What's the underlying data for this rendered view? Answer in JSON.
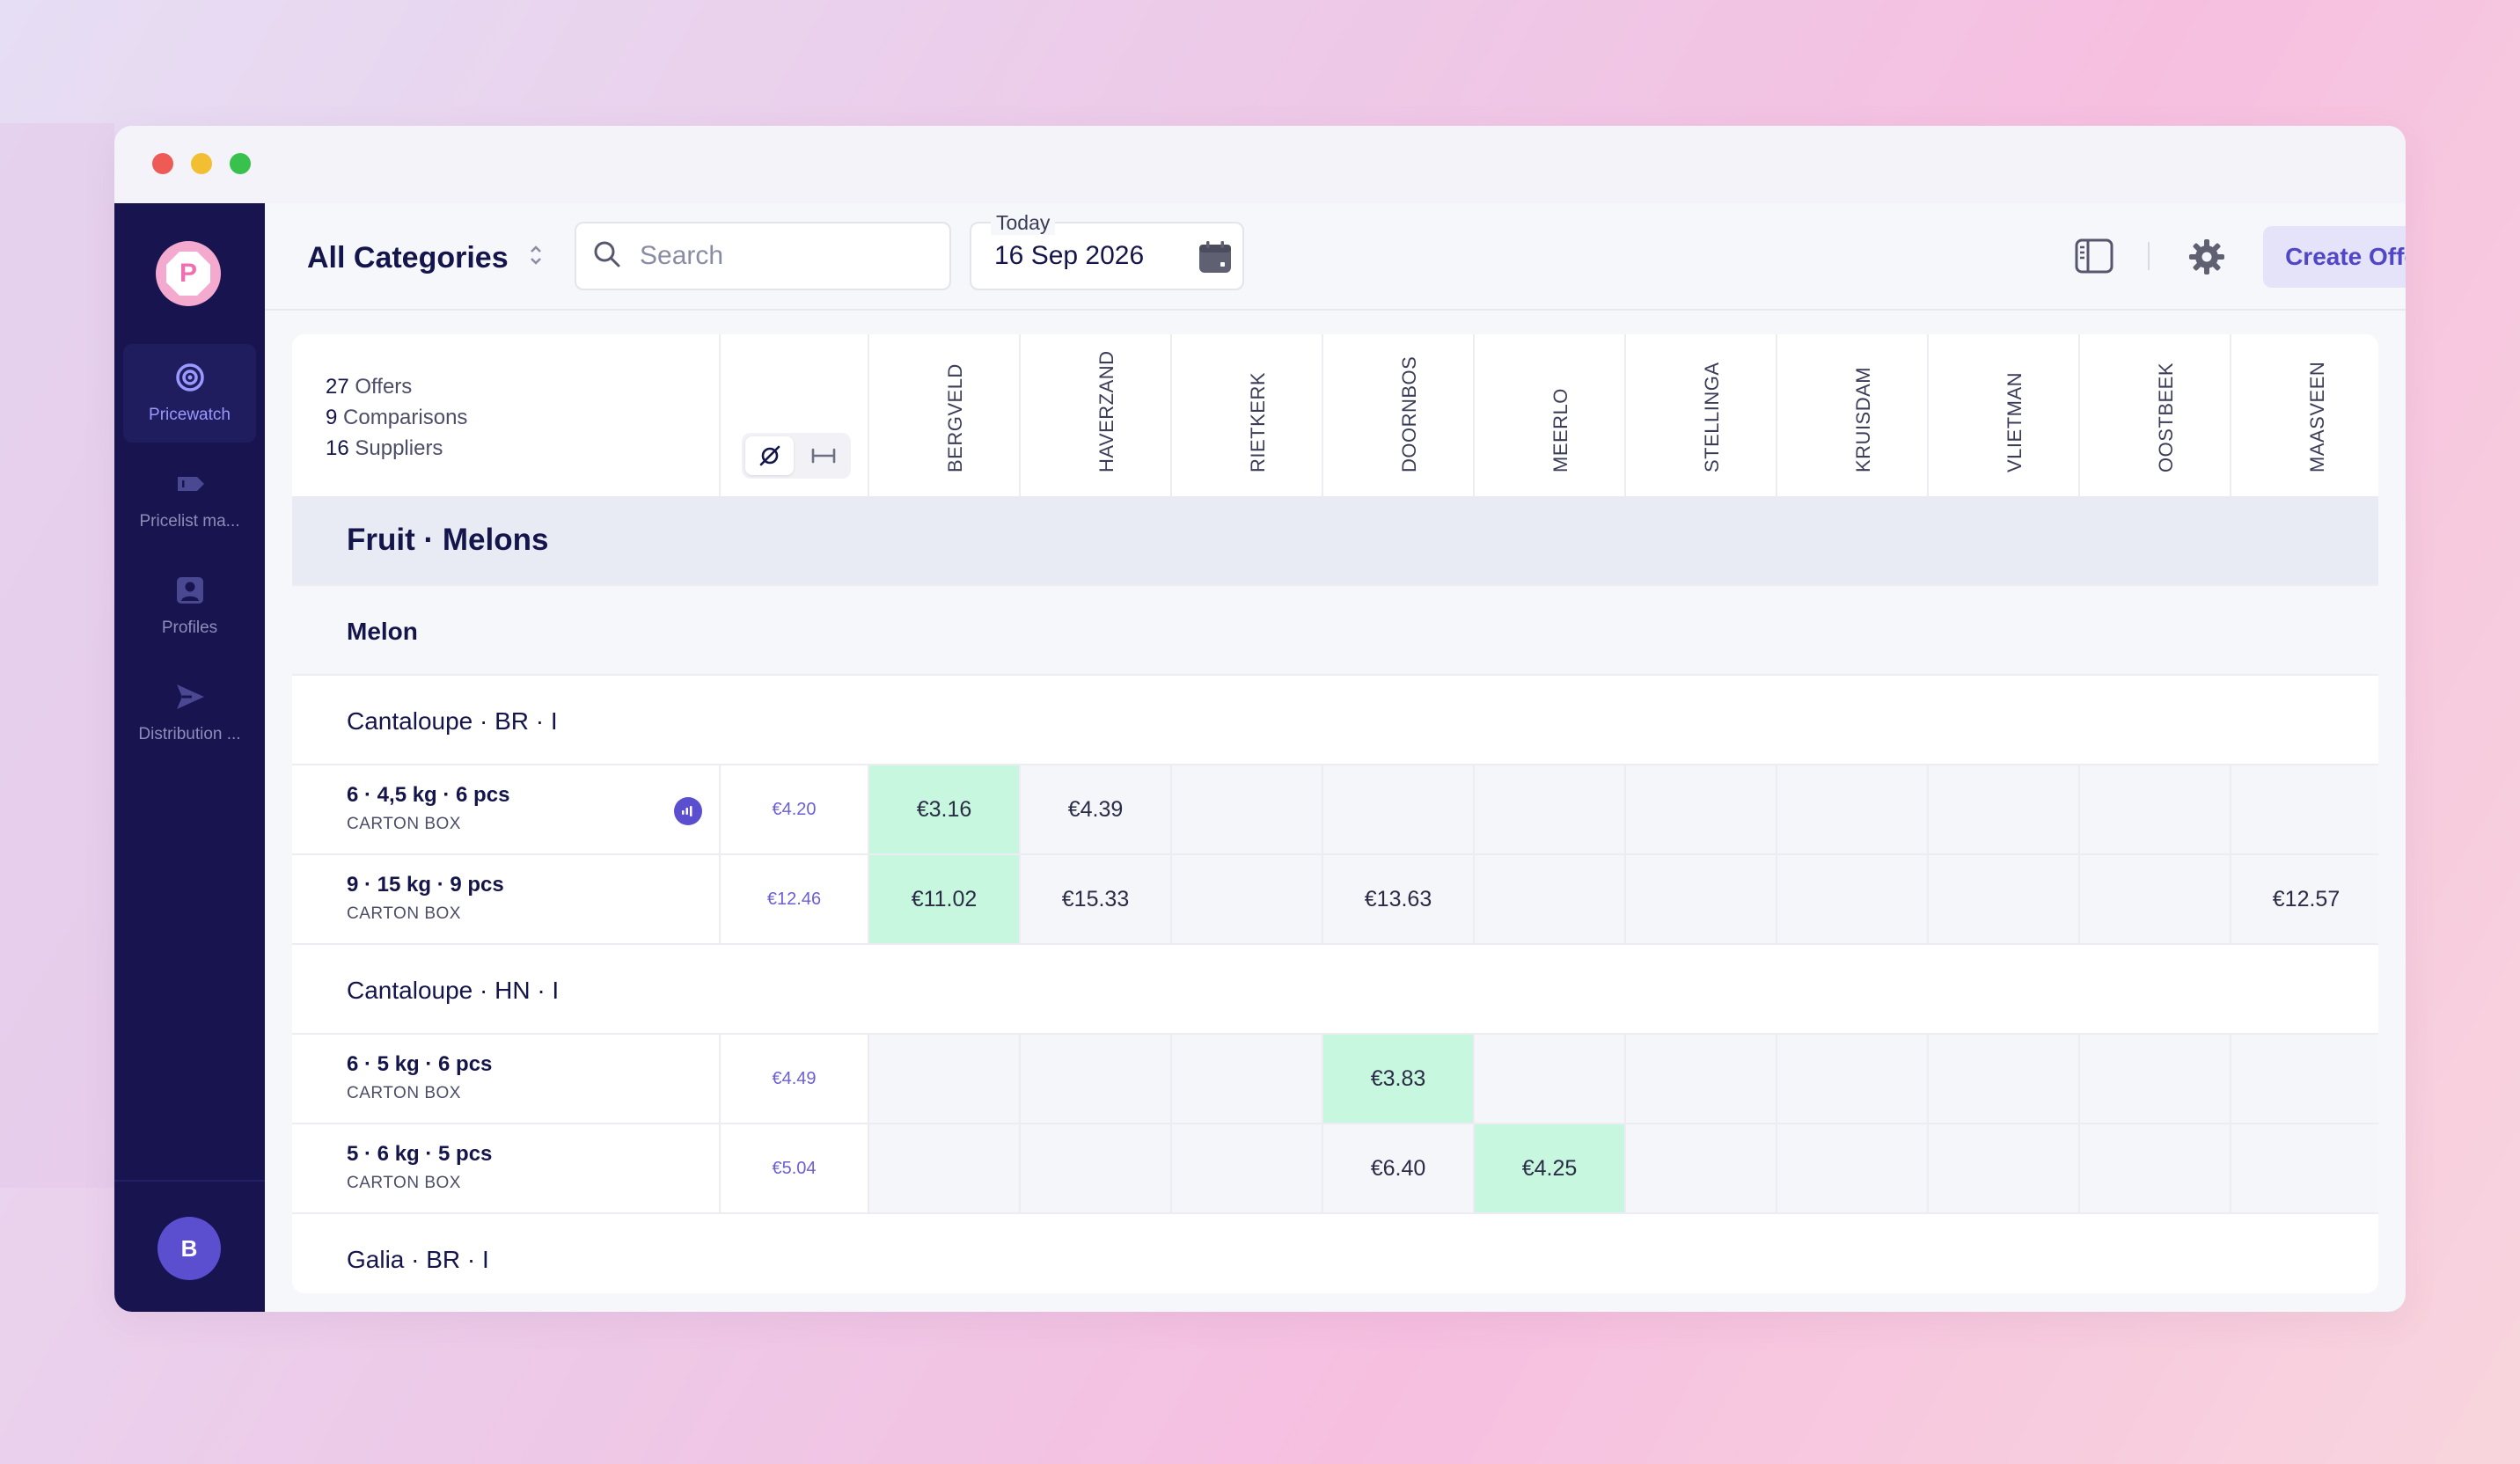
{
  "window": {
    "title": ""
  },
  "sidebar": {
    "logo_letter": "P",
    "items": [
      {
        "label": "Pricewatch",
        "icon": "target-icon",
        "active": true
      },
      {
        "label": "Pricelist ma...",
        "icon": "tag-icon",
        "active": false
      },
      {
        "label": "Profiles",
        "icon": "user-icon",
        "active": false
      },
      {
        "label": "Distribution ...",
        "icon": "send-icon",
        "active": false
      }
    ],
    "avatar_letter": "B"
  },
  "toolbar": {
    "category": "All Categories",
    "search_placeholder": "Search",
    "date_label": "Today",
    "date_value": "16 Sep 2026",
    "create_label": "Create Offer"
  },
  "summary": {
    "offers_count": "27",
    "offers_label": "Offers",
    "comparisons_count": "9",
    "comparisons_label": "Comparisons",
    "suppliers_count": "16",
    "suppliers_label": "Suppliers"
  },
  "suppliers": [
    "BERGVELD",
    "HAVERZAND",
    "RIETKERK",
    "DOORNBOS",
    "MEERLO",
    "STELLINGA",
    "KRUISDAM",
    "VLIETMAN",
    "OOSTBEEK",
    "MAASVEEN"
  ],
  "group": {
    "title": "Fruit · Melons"
  },
  "subgroup": {
    "title": "Melon"
  },
  "varieties": [
    {
      "title": "Cantaloupe · BR · I",
      "items": [
        {
          "label": "6 · 4,5 kg · 6 pcs",
          "pack": "CARTON BOX",
          "ref": "€4.20",
          "has_badge": true,
          "prices": [
            "€3.16",
            "€4.39",
            "",
            "",
            "",
            "",
            "",
            "",
            "",
            ""
          ],
          "best": 0
        },
        {
          "label": "9 · 15 kg · 9 pcs",
          "pack": "CARTON BOX",
          "ref": "€12.46",
          "has_badge": false,
          "prices": [
            "€11.02",
            "€15.33",
            "",
            "€13.63",
            "",
            "",
            "",
            "",
            "",
            "€12.57"
          ],
          "best": 0
        }
      ]
    },
    {
      "title": "Cantaloupe · HN · I",
      "items": [
        {
          "label": "6 · 5 kg · 6 pcs",
          "pack": "CARTON BOX",
          "ref": "€4.49",
          "has_badge": false,
          "prices": [
            "",
            "",
            "",
            "€3.83",
            "",
            "",
            "",
            "",
            "",
            ""
          ],
          "best": 3
        },
        {
          "label": "5 · 6 kg · 5 pcs",
          "pack": "CARTON BOX",
          "ref": "€5.04",
          "has_badge": false,
          "prices": [
            "",
            "",
            "",
            "€6.40",
            "€4.25",
            "",
            "",
            "",
            "",
            ""
          ],
          "best": 4
        }
      ]
    },
    {
      "title": "Galia · BR · I",
      "items": []
    }
  ],
  "colors": {
    "sidebar": "#171450",
    "accent": "#5b4fd0",
    "best_price": "#c8f7df"
  }
}
